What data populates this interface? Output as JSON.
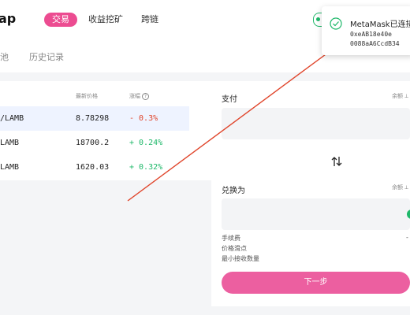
{
  "header": {
    "logo": "ap",
    "tabs": [
      {
        "label": "交易",
        "active": true
      },
      {
        "label": "收益挖矿",
        "active": false
      },
      {
        "label": "跨链",
        "active": false
      }
    ]
  },
  "subtabs": [
    "池",
    "历史记录"
  ],
  "pairs": {
    "columns": {
      "price": "最新价格",
      "change": "涨幅"
    },
    "rows": [
      {
        "pair": "/LAMB",
        "price": "8.78298",
        "change": "- 0.3%",
        "trend": "down",
        "selected": true
      },
      {
        "pair": "LAMB",
        "price": "18700.2",
        "change": "+ 0.24%",
        "trend": "up",
        "selected": false
      },
      {
        "pair": "LAMB",
        "price": "1620.03",
        "change": "+ 0.32%",
        "trend": "up",
        "selected": false
      }
    ]
  },
  "swap": {
    "pay_label": "支付",
    "receive_label": "兑换为",
    "balance_label": "余额",
    "fee_label": "手续费",
    "slippage_label": "价格滑点",
    "min_received_label": "最小接收数量",
    "next_button": "下一步"
  },
  "toast": {
    "title": "MetaMask已连接",
    "address_line1": "0xeAB18e40e",
    "address_line2": "0088aA6CcdB34"
  },
  "colors": {
    "accent": "#ec4c91",
    "positive": "#1fb86a",
    "negative": "#e0452b",
    "annotation_arrow": "#e0452b"
  }
}
